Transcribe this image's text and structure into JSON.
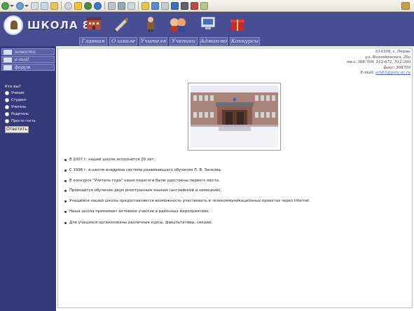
{
  "site": {
    "logo_text": "ШКОЛА 83"
  },
  "nav": [
    {
      "label": "Главная",
      "icon": "school-building-icon"
    },
    {
      "label": "О школе",
      "icon": "pen-icon"
    },
    {
      "label": "Учителя",
      "icon": "teacher-icon"
    },
    {
      "label": "Ученики",
      "icon": "students-icon"
    },
    {
      "label": "Админ-во",
      "icon": "admin-icon"
    },
    {
      "label": "Конкурсы",
      "icon": "gift-icon"
    }
  ],
  "sidebar": {
    "links": [
      {
        "label": "новости"
      },
      {
        "label": "e-mail"
      },
      {
        "label": "форум"
      }
    ],
    "poll": {
      "question": "Кто вы?",
      "options": [
        "Ученик",
        "Студент",
        "Учитель",
        "Родитель",
        "Просто гость"
      ],
      "button": "Ответить"
    }
  },
  "contact": {
    "lines": [
      "614109, г. Пермь",
      "ул. Волгодонская, 20а",
      "тел. 308-709, 512-672, 512-260",
      "факс: 308709"
    ],
    "email_label": "E-mail:",
    "email": "sch83@pstu.ac.ru"
  },
  "photo": {
    "alt_name": "school-building-photo"
  },
  "bullets": [
    "В 2007 г. нашей школе исполнится 20 лет.",
    "С 1998 г. в школе внедрена система развивающего обучения Л. В. Занкова.",
    "В конкурсе \"Учитель года\" наши педагоги были удостоены первого места.",
    "Проводится обучение двум иностранным языкам (английский и немецкий).",
    "Учащимся нашей школы предоставляется возможность участвовать в телекоммуникационных проектах через Internet.",
    "Наша школа принимает активное участие в районных мероприятиях.",
    "Для учащихся организованы различные курсы, факультативы, секции."
  ],
  "colors": {
    "header": "#484e91",
    "sidebar": "#35397a",
    "nav_button": "#5b61a6",
    "link": "#4a57c8"
  }
}
